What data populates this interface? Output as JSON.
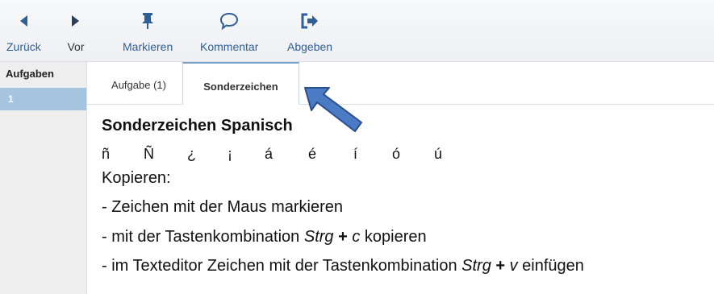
{
  "toolbar": {
    "back_label": "Zurück",
    "forward_label": "Vor",
    "mark_label": "Markieren",
    "comment_label": "Kommentar",
    "submit_label": "Abgeben"
  },
  "sidebar": {
    "heading": "Aufgaben",
    "items": [
      {
        "label": "1"
      }
    ]
  },
  "tabs": [
    {
      "label": "Aufgabe (1)"
    },
    {
      "label": "Sonderzeichen"
    }
  ],
  "content": {
    "title": "Sonderzeichen Spanisch",
    "chars": [
      "ñ",
      "Ñ",
      "¿",
      "¡",
      "á",
      "é",
      "í",
      "ó",
      "ú"
    ],
    "copy_heading": "Kopieren:",
    "step1": "- Zeichen mit der Maus markieren",
    "step2_pre": "- mit der Tastenkombination ",
    "step2_key1": "Strg",
    "step2_plus": " + ",
    "step2_key2": "c",
    "step2_post": " kopieren",
    "step3_pre": "- im Texteditor Zeichen mit der Tastenkombination ",
    "step3_key1": "Strg",
    "step3_plus": " + ",
    "step3_key2": "v",
    "step3_post": " einfügen"
  },
  "colors": {
    "accent": "#2f5f97",
    "selected_item": "#a6c4e0",
    "arrow_fill": "#4a7bc4",
    "arrow_stroke": "#2b4f8c"
  }
}
